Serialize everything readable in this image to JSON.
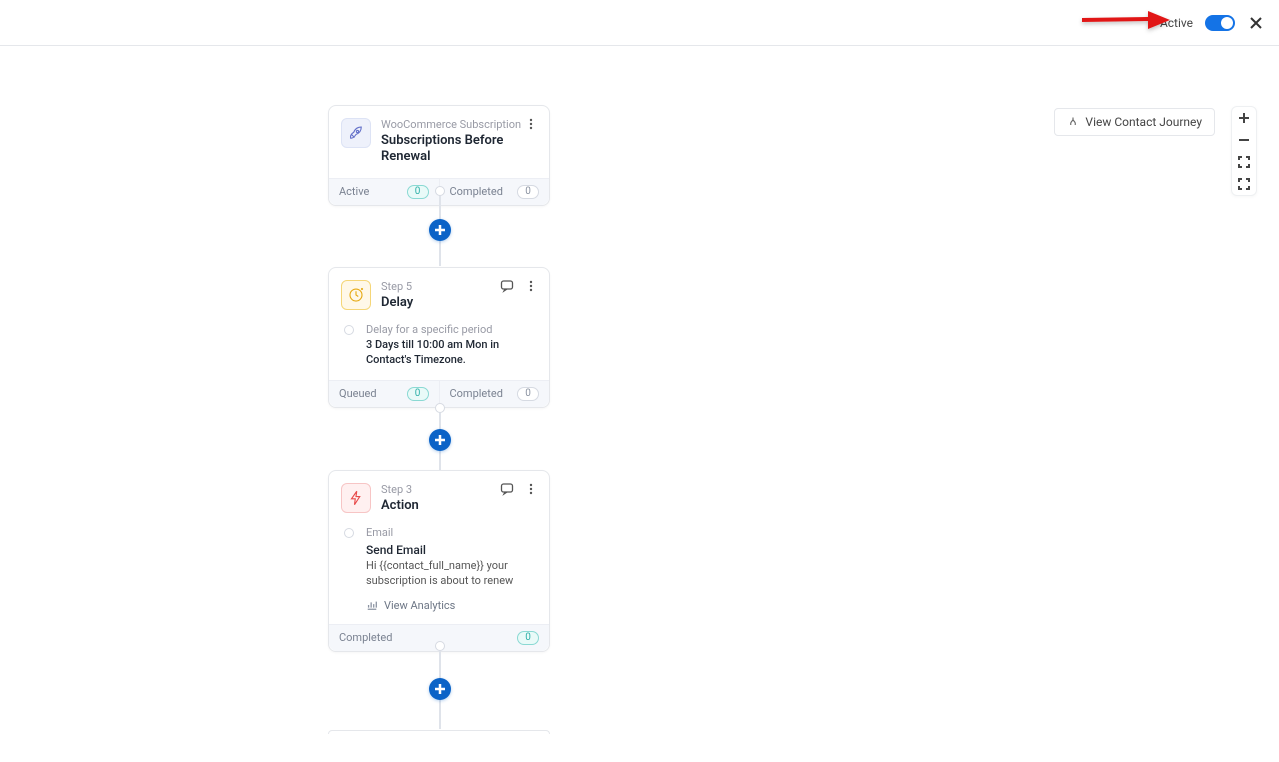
{
  "header": {
    "active_label": "Active"
  },
  "vcj_label": "View Contact Journey",
  "cards": {
    "trigger": {
      "overline": "WooCommerce Subscription",
      "title": "Subscriptions Before Renewal",
      "foot": {
        "left_label": "Active",
        "left_count": "0",
        "right_label": "Completed",
        "right_count": "0"
      }
    },
    "delay": {
      "overline": "Step 5",
      "title": "Delay",
      "body_label": "Delay for a specific period",
      "body_desc": "3 Days till 10:00 am Mon in Contact's Timezone.",
      "foot": {
        "left_label": "Queued",
        "left_count": "0",
        "right_label": "Completed",
        "right_count": "0"
      }
    },
    "action": {
      "overline": "Step 3",
      "title": "Action",
      "body_label": "Email",
      "body_title": "Send Email",
      "body_desc": "Hi {{contact_full_name}} your subscription is about to renew",
      "view_analytics": "View Analytics",
      "foot": {
        "label": "Completed",
        "count": "0"
      }
    }
  }
}
